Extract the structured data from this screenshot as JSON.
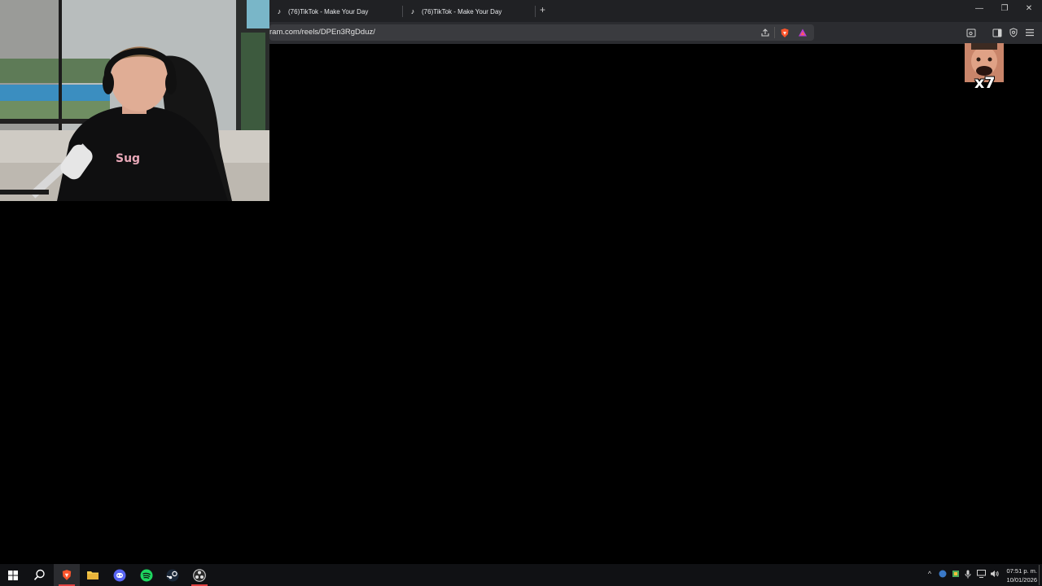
{
  "browser": {
    "tabs": [
      {
        "title": "(76)TikTok - Make Your Day",
        "icon": "tiktok-icon"
      },
      {
        "title": "(76)TikTok - Make Your Day",
        "icon": "tiktok-icon"
      }
    ],
    "new_tab_label": "+",
    "url": "ram.com/reels/DPEn3RgDduz/",
    "window_controls": {
      "minimize": "—",
      "restore": "❐",
      "close": "✕"
    }
  },
  "overlay": {
    "emote_count": "x7"
  },
  "taskbar": {
    "apps": [
      {
        "name": "start",
        "icon": "windows-icon"
      },
      {
        "name": "search",
        "icon": "search-icon"
      },
      {
        "name": "brave",
        "icon": "brave-icon",
        "active": true
      },
      {
        "name": "file-explorer",
        "icon": "folder-icon"
      },
      {
        "name": "discord",
        "icon": "discord-icon"
      },
      {
        "name": "spotify",
        "icon": "spotify-icon"
      },
      {
        "name": "steam",
        "icon": "steam-icon"
      },
      {
        "name": "obs",
        "icon": "obs-icon"
      }
    ],
    "clock": {
      "time": "07:51 p. m.",
      "date": "10/01/2026"
    }
  },
  "colors": {
    "accent_red": "#fb542b",
    "spotify_green": "#1ed760",
    "discord_blurple": "#5865f2"
  }
}
